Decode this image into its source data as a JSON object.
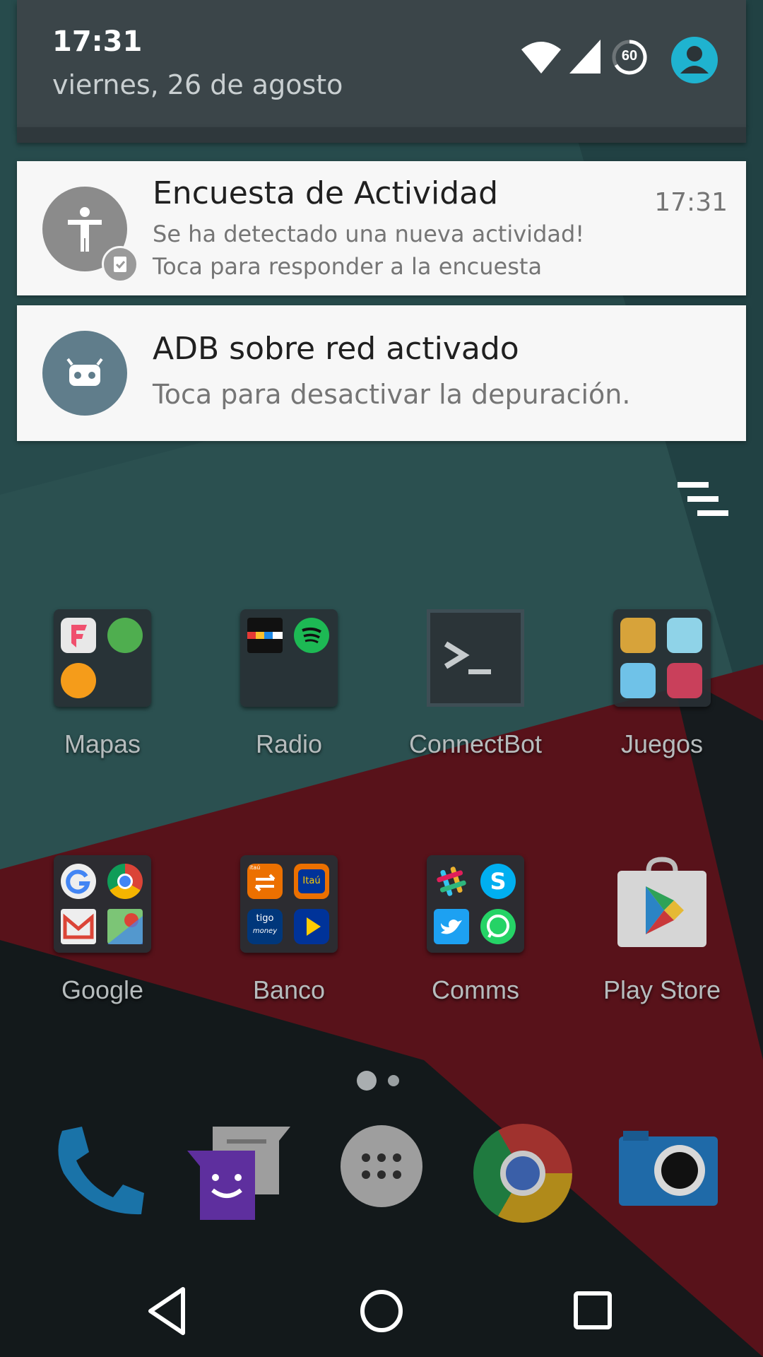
{
  "status": {
    "time": "17:31",
    "date": "viernes, 26 de agosto",
    "battery_level": "60"
  },
  "notifications": [
    {
      "title": "Encuesta de Actividad",
      "time": "17:31",
      "line1": "Se ha detectado una nueva actividad!",
      "line2": "Toca para responder a la encuesta",
      "icon": "accessibility-icon"
    },
    {
      "title": "ADB sobre red activado",
      "line1": "Toca para desactivar la depuración.",
      "icon": "android-debug-icon"
    }
  ],
  "home": {
    "row1": [
      {
        "label": "Mapas",
        "type": "folder"
      },
      {
        "label": "Radio",
        "type": "folder"
      },
      {
        "label": "ConnectBot",
        "type": "app"
      },
      {
        "label": "Juegos",
        "type": "folder"
      }
    ],
    "row2": [
      {
        "label": "Google",
        "type": "folder"
      },
      {
        "label": "Banco",
        "type": "folder"
      },
      {
        "label": "Comms",
        "type": "folder"
      },
      {
        "label": "Play Store",
        "type": "app"
      }
    ],
    "banco_minis": {
      "itau_small": "itaú",
      "itau": "Itaú",
      "tigo": "tigo",
      "money": "money"
    },
    "current_page": 1,
    "page_count": 2
  },
  "dock": [
    "phone-icon",
    "messenger-icon",
    "app-drawer-icon",
    "chrome-icon",
    "camera-icon"
  ],
  "colors": {
    "accent_teal": "#1fb3d0",
    "notif_bg": "#f7f7f7",
    "header_bg": "#3b4549",
    "wallpaper_red": "#7a1a24",
    "wallpaper_teal": "#2e6a6a"
  }
}
